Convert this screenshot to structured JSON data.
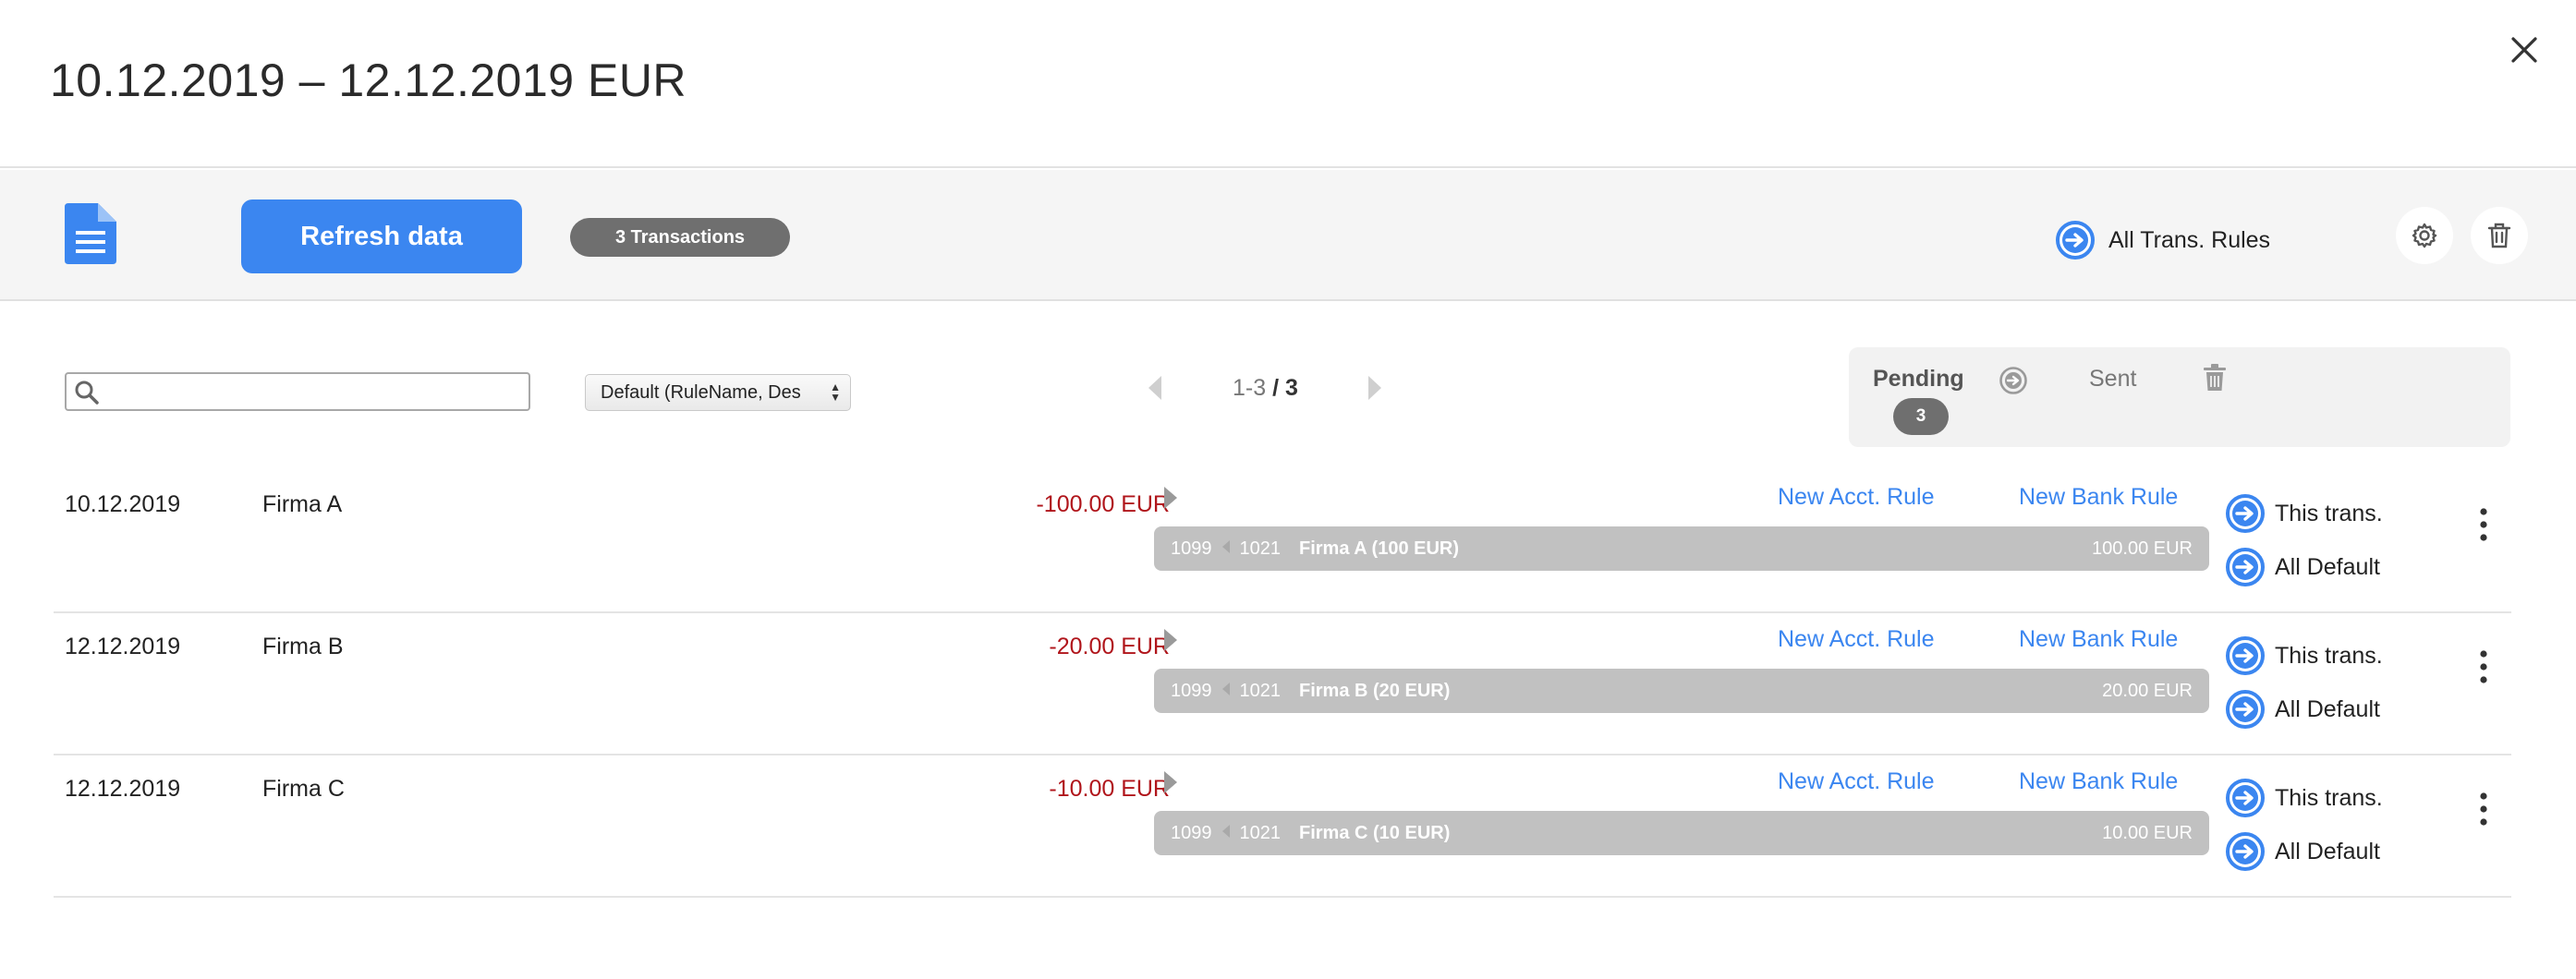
{
  "header": {
    "title": "10.12.2019 – 12.12.2019 EUR"
  },
  "toolbar": {
    "refresh_label": "Refresh data",
    "transactions_badge": "3 Transactions",
    "all_rules_label": "All Trans. Rules"
  },
  "filters": {
    "search_placeholder": "",
    "sort_selected": "Default (RuleName, Des"
  },
  "pager": {
    "range": "1-3",
    "total": "/ 3"
  },
  "status": {
    "pending_label": "Pending",
    "pending_count": "3",
    "sent_label": "Sent"
  },
  "labels": {
    "new_acct_rule": "New Acct. Rule",
    "new_bank_rule": "New Bank Rule",
    "this_trans": "This trans.",
    "all_default": "All Default"
  },
  "transactions": [
    {
      "date": "10.12.2019",
      "name": "Firma A",
      "amount": "-100.00 EUR",
      "rule": {
        "acct_from": "1099",
        "acct_to": "1021",
        "name": "Firma A (100 EUR)",
        "amount": "100.00 EUR"
      }
    },
    {
      "date": "12.12.2019",
      "name": "Firma B",
      "amount": "-20.00 EUR",
      "rule": {
        "acct_from": "1099",
        "acct_to": "1021",
        "name": "Firma B (20 EUR)",
        "amount": "20.00 EUR"
      }
    },
    {
      "date": "12.12.2019",
      "name": "Firma C",
      "amount": "-10.00 EUR",
      "rule": {
        "acct_from": "1099",
        "acct_to": "1021",
        "name": "Firma C (10 EUR)",
        "amount": "10.00 EUR"
      }
    }
  ],
  "colors": {
    "accent": "#3b86f0",
    "negative": "#b0151b",
    "badge": "#6f6f6f",
    "rule_bar": "#c1c1c1"
  }
}
